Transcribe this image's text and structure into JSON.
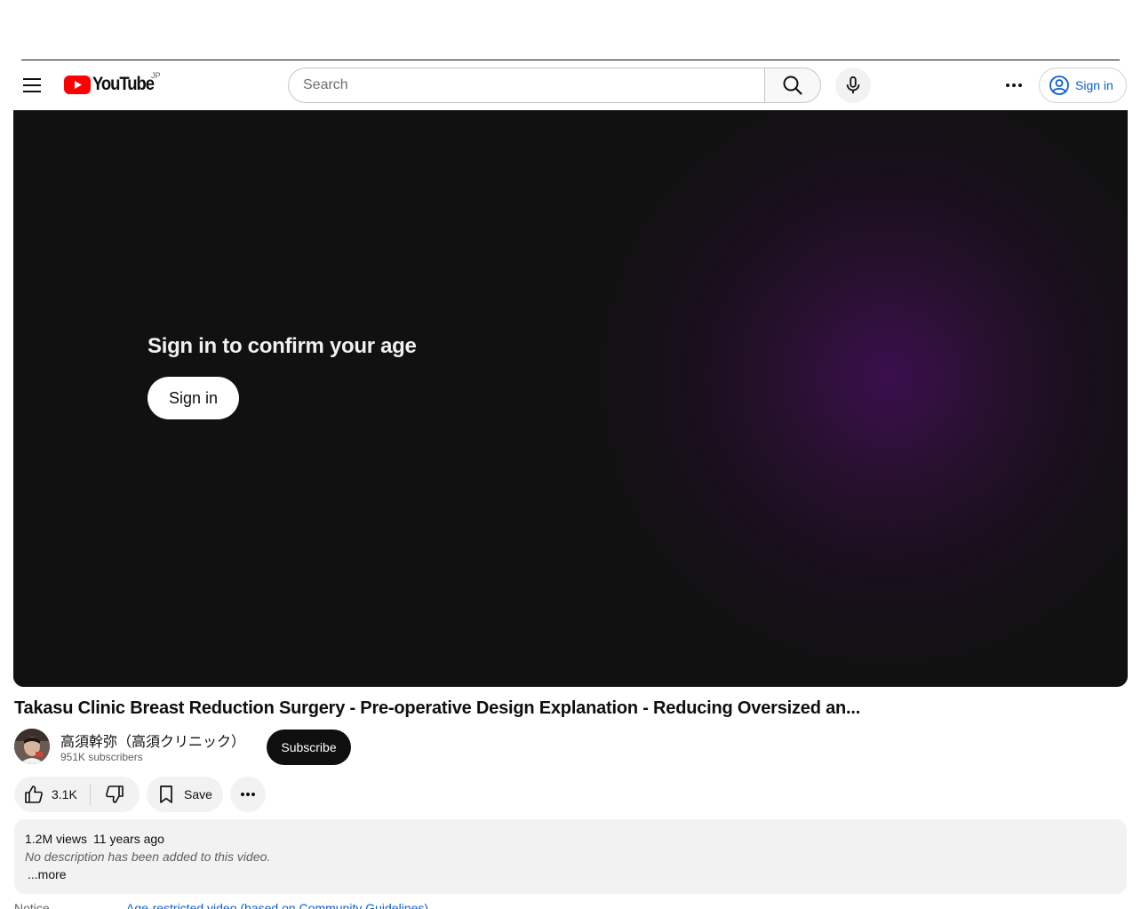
{
  "header": {
    "logo_text": "YouTube",
    "region": "JP",
    "search_placeholder": "Search",
    "signin_label": "Sign in"
  },
  "player": {
    "age_gate_title": "Sign in to confirm your age",
    "age_gate_button": "Sign in"
  },
  "video": {
    "title": "Takasu Clinic Breast Reduction Surgery - Pre-operative Design Explanation - Reducing Oversized an...",
    "channel_name": "高須幹弥（高須クリニック）",
    "subscribers": "951K subscribers",
    "subscribe_label": "Subscribe",
    "likes": "3.1K",
    "save_label": "Save"
  },
  "description": {
    "views": "1.2M views",
    "age": "11 years ago",
    "text": "No description has been added to this video.",
    "more_label": "...more"
  },
  "notice": {
    "label": "Notice",
    "link": "Age-restricted video (based on Community Guidelines)"
  },
  "colors": {
    "brand_red": "#ff0000",
    "link_blue": "#065fd4",
    "player_bg": "#121112",
    "player_glow": "#3a0f4d"
  }
}
